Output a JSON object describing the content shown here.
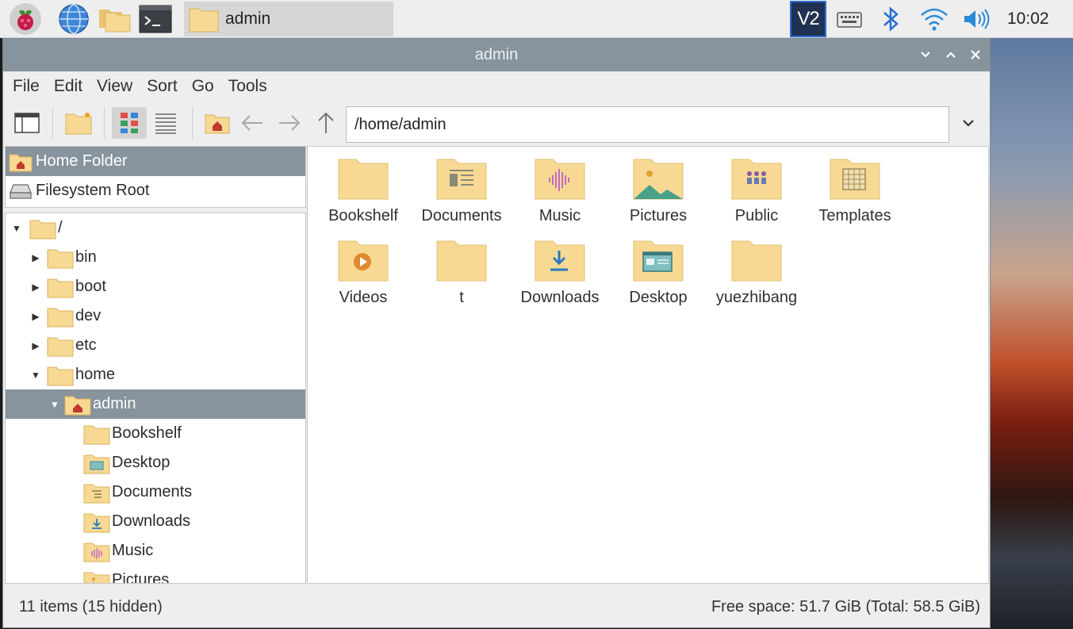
{
  "taskbar": {
    "active_task": "admin",
    "clock": "10:02",
    "vnc_label": "V2"
  },
  "window": {
    "title": "admin",
    "controls": {
      "minimize": "⌄",
      "maximize": "⌃",
      "close": "✕"
    }
  },
  "menu": [
    "File",
    "Edit",
    "View",
    "Sort",
    "Go",
    "Tools"
  ],
  "toolbar": {
    "path": "/home/admin"
  },
  "places": [
    {
      "label": "Home Folder",
      "icon": "home-folder-icon",
      "selected": true
    },
    {
      "label": "Filesystem Root",
      "icon": "drive-icon",
      "selected": false
    }
  ],
  "tree": [
    {
      "label": "/",
      "level": 0,
      "expander": "down"
    },
    {
      "label": "bin",
      "level": 1,
      "expander": "right"
    },
    {
      "label": "boot",
      "level": 1,
      "expander": "right"
    },
    {
      "label": "dev",
      "level": 1,
      "expander": "right"
    },
    {
      "label": "etc",
      "level": 1,
      "expander": "right"
    },
    {
      "label": "home",
      "level": 1,
      "expander": "down"
    },
    {
      "label": "admin",
      "level": 2,
      "expander": "down",
      "selected": true
    },
    {
      "label": "Bookshelf",
      "level": 3,
      "expander": "none"
    },
    {
      "label": "Desktop",
      "level": 3,
      "expander": "none"
    },
    {
      "label": "Documents",
      "level": 3,
      "expander": "none"
    },
    {
      "label": "Downloads",
      "level": 3,
      "expander": "none"
    },
    {
      "label": "Music",
      "level": 3,
      "expander": "none"
    },
    {
      "label": "Pictures",
      "level": 3,
      "expander": "none"
    }
  ],
  "items": [
    {
      "label": "Bookshelf",
      "icon": "folder-icon"
    },
    {
      "label": "Documents",
      "icon": "folder-documents-icon"
    },
    {
      "label": "Music",
      "icon": "folder-music-icon"
    },
    {
      "label": "Pictures",
      "icon": "folder-pictures-icon"
    },
    {
      "label": "Public",
      "icon": "folder-public-icon"
    },
    {
      "label": "Templates",
      "icon": "folder-templates-icon"
    },
    {
      "label": "Videos",
      "icon": "folder-videos-icon"
    },
    {
      "label": "t",
      "icon": "folder-icon"
    },
    {
      "label": "Downloads",
      "icon": "folder-downloads-icon"
    },
    {
      "label": "Desktop",
      "icon": "folder-desktop-icon"
    },
    {
      "label": "yuezhibang",
      "icon": "folder-icon"
    }
  ],
  "status": {
    "left": "11 items (15 hidden)",
    "right": "Free space: 51.7 GiB (Total: 58.5 GiB)"
  },
  "colors": {
    "folder": "#f7d994",
    "folder_dark": "#e9c46f",
    "selection": "#87939d",
    "titlebar": "#87939d"
  }
}
